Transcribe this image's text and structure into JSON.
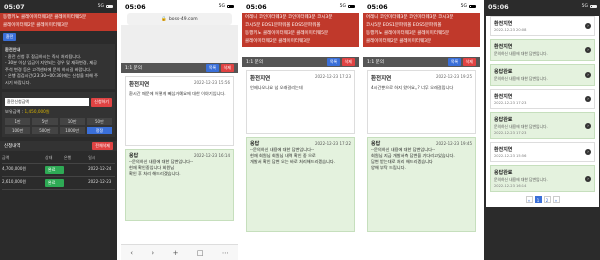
{
  "status": {
    "p1_time": "05:07",
    "p2_time": "05:06",
    "p3_time": "05:06",
    "p4_time": "05:06",
    "p5_time": "05:06",
    "signal": "5G"
  },
  "url": "boss-49.com",
  "ticker": {
    "p1_line1": "동행키노 클레이미터웨3분 클레이미터웨5분",
    "p1_line2": "클레이미터웨2분 클레이미터웨3분",
    "p3_line1": "어레니 코인미터웨3분 코인미터웨3분 코시3분",
    "p3_line2": "코시5분 EOS1분파워볼 EOS5분파워볼",
    "p3_line3": "동행키노 클레이미터웨3분 클레이미터웨5분",
    "p3_line4": "클레이미터웨2분 클레이미터웨3분"
  },
  "p1": {
    "header": "환전",
    "section": "환전안내",
    "notes": [
      "- 환전 신청 후 잠금하시는 즉시 처리됩니다.",
      "- 30분 이상 입금이 지연되는 경우 및 재화변경, 제공",
      "주석 변경 등은 고객센터에 문의 하시길 바랍니다.",
      "- 은행 점검시간(23:30~00:30)에는 신청을 피해 주",
      "시기 바랍니다."
    ],
    "amount_placeholder": "환전신청금액",
    "request_btn": "신청하기",
    "balance_label": "보유금액 :",
    "balance_value": "1,450,000원",
    "amounts": [
      "1만",
      "5만",
      "10만",
      "50만",
      "100만",
      "500만",
      "1000만",
      "정정"
    ],
    "history_title": "신청내역",
    "history_btn": "전체삭제",
    "columns": [
      "금액",
      "상태",
      "은행",
      "일시"
    ],
    "rows": [
      {
        "amount": "4,700,000원",
        "status": "완료",
        "bank": "",
        "date": "2022-12-24"
      },
      {
        "amount": "2,610,000원",
        "status": "완료",
        "bank": "",
        "date": "2022-12-23"
      }
    ]
  },
  "p2": {
    "board": "1:1 문의",
    "write_btn": "목록",
    "delete_btn": "삭제",
    "title": "환전지연",
    "date": "2022-12-23 15:56",
    "body": "환시간 때문에 어떻게 빼심거예요에 대한 이야기입니다.",
    "answer_label": "응답",
    "answer_date": "2022-12-23 16:14",
    "answer_body": [
      "--문의하신 내용에 대한 답변입니다--",
      "현재 확인중입니다 회원님",
      "",
      "확인 후 처리 해드리겠습니다."
    ]
  },
  "p3": {
    "board": "1:1 문의",
    "write_btn": "목록",
    "delete_btn": "삭제",
    "title": "환전지연",
    "date": "2022-12-23 17:23",
    "body": "언제나오나요 넘 오래걸리는데",
    "answer_label": "응답",
    "answer_date": "2022-12-23 17:22",
    "answer_body": [
      "--문의하신 내용에 대한 답변입니다--",
      "현재 회원님 회원님 내역 확인 중 으로",
      "",
      "개발서 확인 답변 오는 바로 처리해드리겠습니다."
    ]
  },
  "p4": {
    "board": "1:1 문의",
    "write_btn": "목록",
    "delete_btn": "삭제",
    "title": "환전지연",
    "date": "2022-12-23 19:25",
    "body": "4시간뿐으로 하지 왔어요,,? 너무 오래걸립니다",
    "answer_label": "응답",
    "answer_date": "2022-12-23 19:45",
    "answer_body": [
      "--문의하신 내용에 대한 답변입니다--",
      "회원님 지금 개발서측 답변을 기다리고있습니다.",
      "",
      "답변 받는대로 처리 해드리겠습니다",
      "",
      "양해 부탁 드립니다."
    ]
  },
  "p5": {
    "items": [
      {
        "title": "환전지연",
        "status": "",
        "date": "2022-12-23 20:08",
        "done": false
      },
      {
        "title": "환전지연",
        "status": "문의하신 내용에 대한 답변입니다.",
        "date": "",
        "done": true
      },
      {
        "title": "응답완료",
        "status": "문의하신 내용에 대한 답변입니다.",
        "date": "",
        "done": true
      },
      {
        "title": "환전지연",
        "status": "",
        "date": "2022-12-23 17:23",
        "done": false
      },
      {
        "title": "응답완료",
        "status": "문의하신 내용에 대한 답변입니다.",
        "date": "2022-12-23 17:23",
        "done": true
      },
      {
        "title": "환전지연",
        "status": "",
        "date": "2022-12-23 15:56",
        "done": false
      },
      {
        "title": "응답완료",
        "status": "문의하신 내용에 대한 답변입니다.",
        "date": "2022-12-23 16:14",
        "done": true
      }
    ],
    "pages": [
      "«",
      "1",
      "2",
      "»"
    ]
  }
}
